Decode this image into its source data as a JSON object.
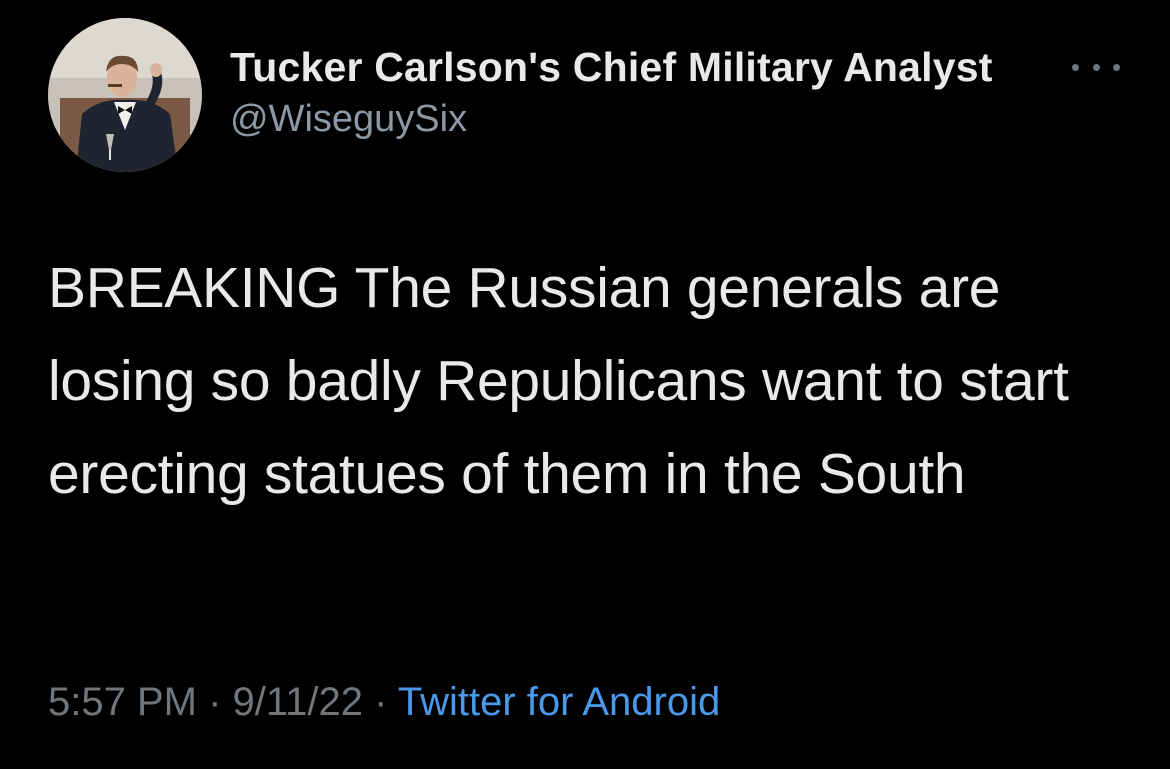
{
  "author": {
    "display_name": "Tucker Carlson's Chief Military Analyst",
    "handle": "@WiseguySix",
    "avatar_icon": "profile-avatar"
  },
  "more_icon": "more-horizontal-icon",
  "tweet": {
    "text": "BREAKING The Russian generals are losing so badly Republicans want to start erecting statues of them in the South"
  },
  "meta": {
    "time": "5:57 PM",
    "separator_1": " · ",
    "date": "9/11/22",
    "separator_2": " · ",
    "source": "Twitter for Android"
  },
  "colors": {
    "background": "#000000",
    "text": "#e7e9ea",
    "secondary": "#71767b",
    "link": "#4a99e9"
  }
}
